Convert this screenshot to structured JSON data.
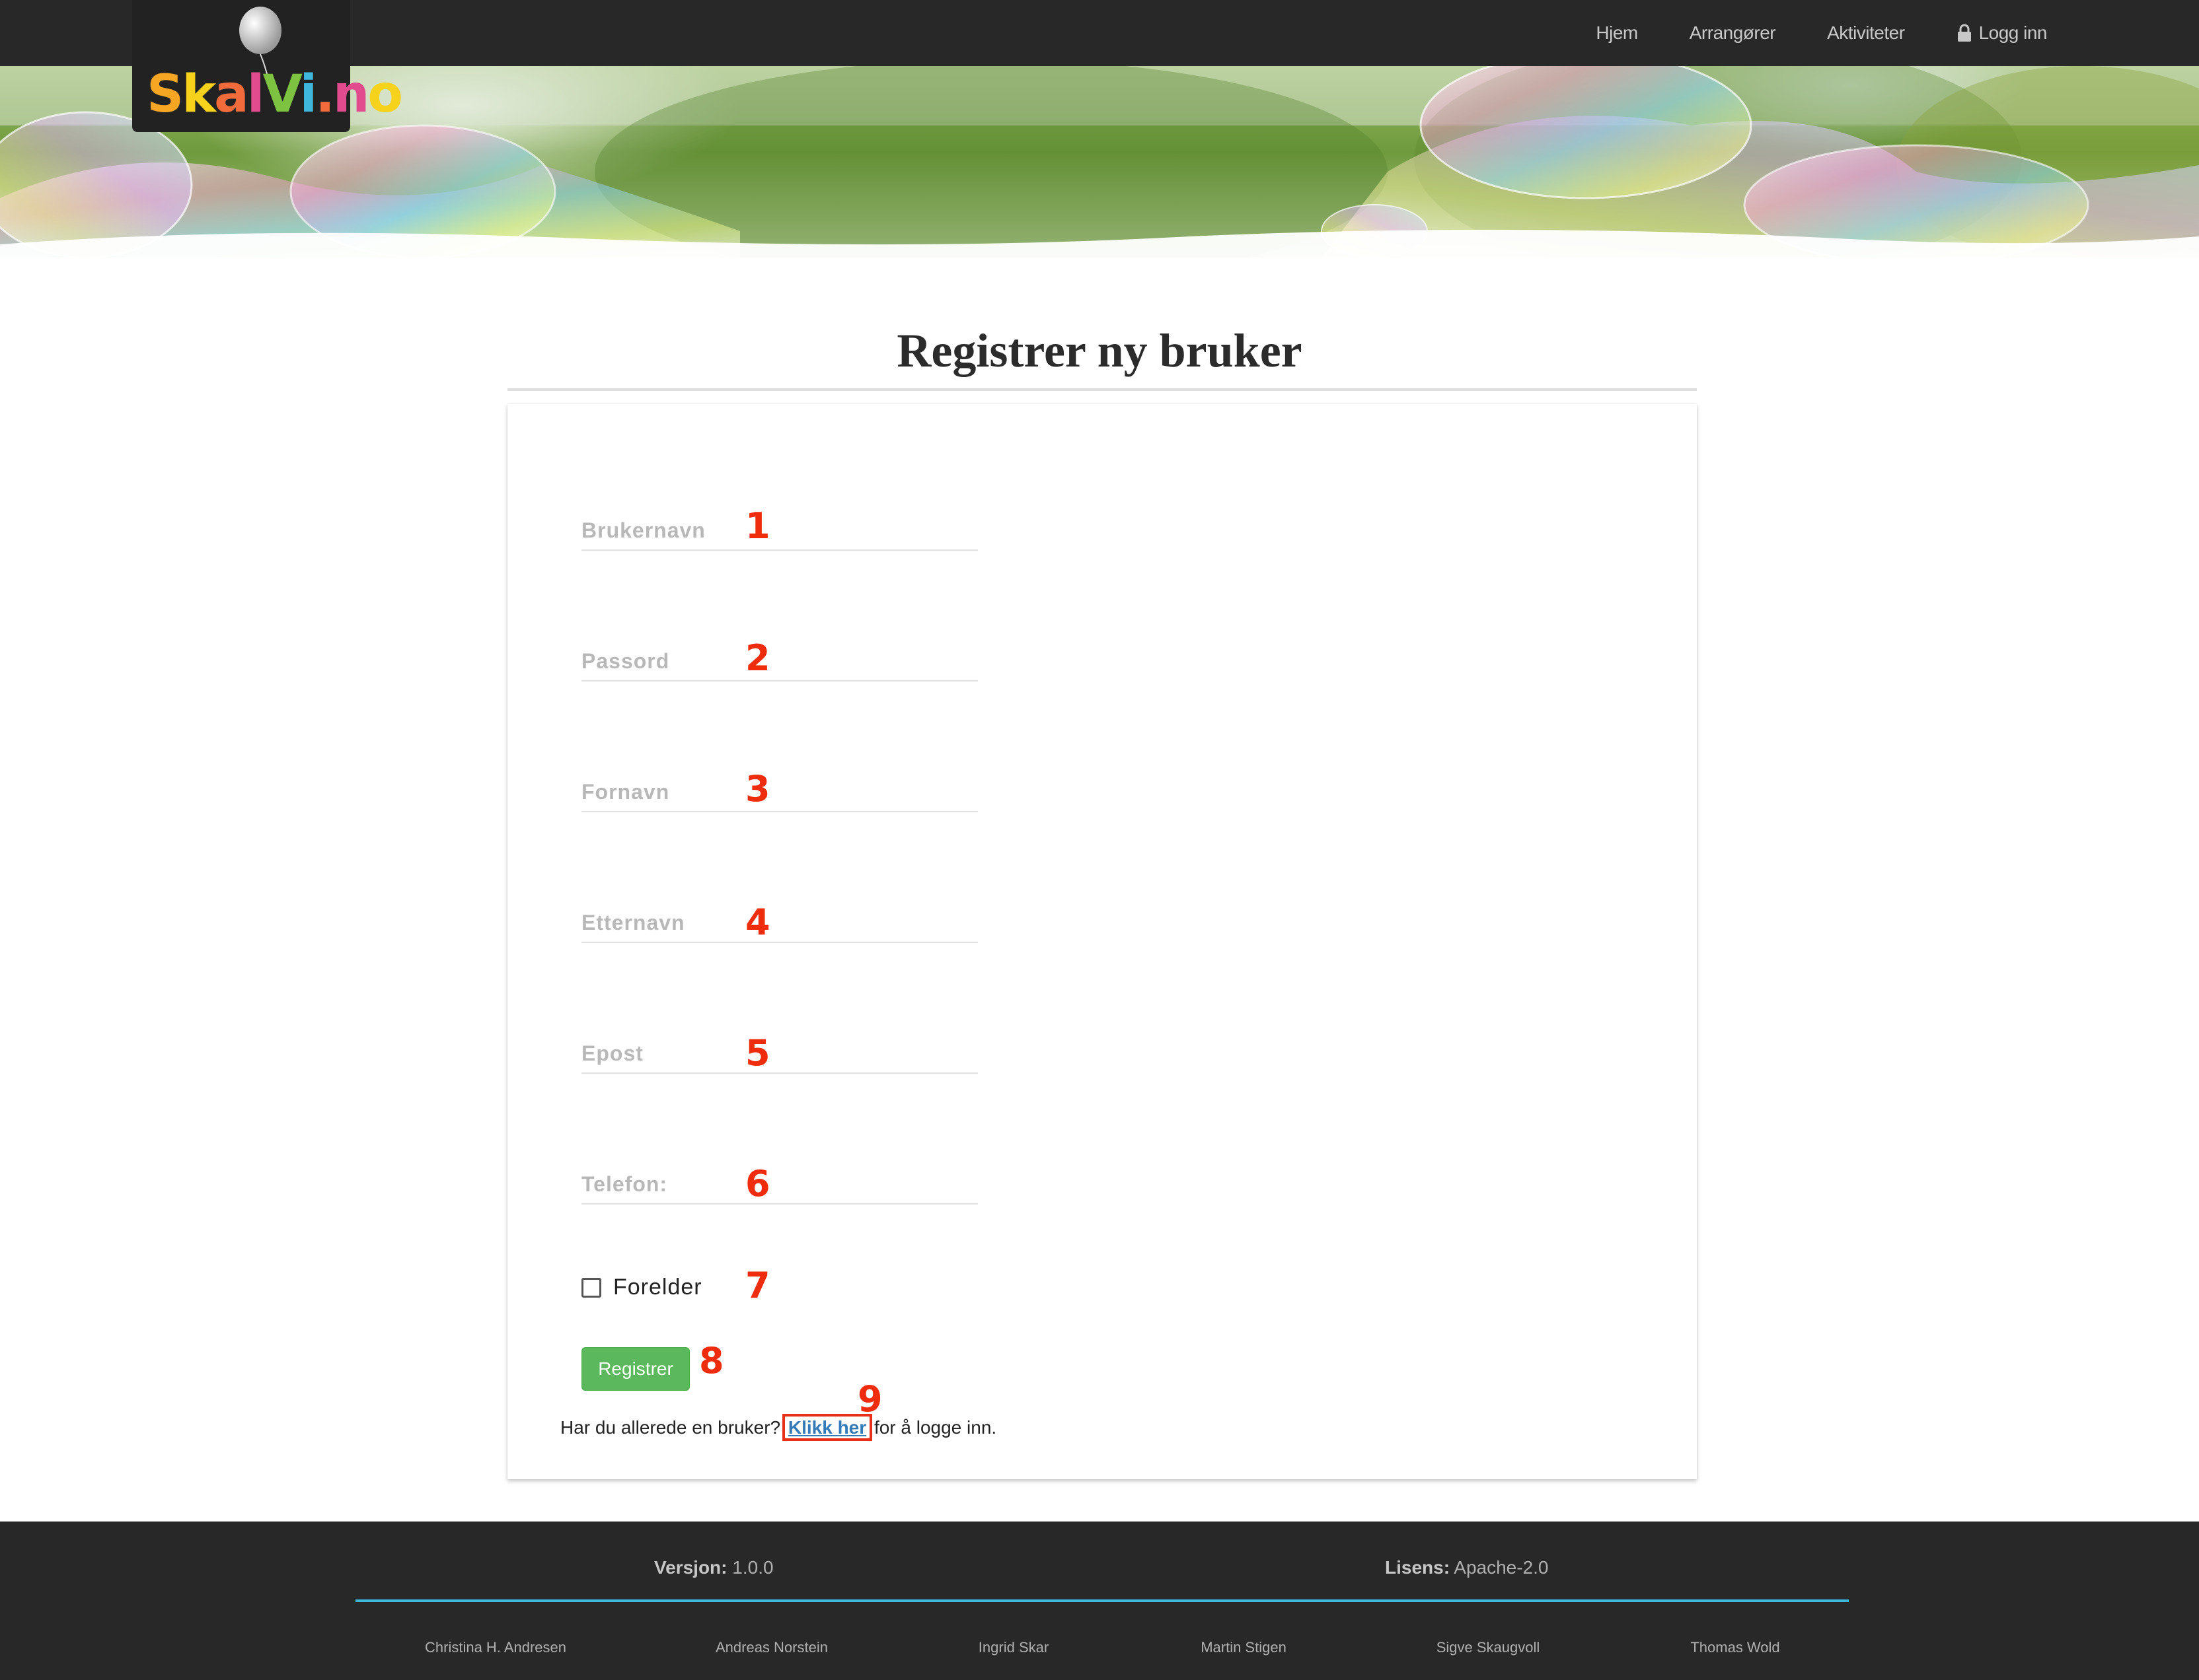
{
  "nav": {
    "logo_text": "SkalVi.no",
    "links": [
      "Hjem",
      "Arrangører",
      "Aktiviteter"
    ],
    "login_label": "Logg inn",
    "login_icon": "lock-icon"
  },
  "page": {
    "title": "Registrer ny bruker"
  },
  "form": {
    "fields": [
      {
        "label": "Brukernavn",
        "value": ""
      },
      {
        "label": "Passord",
        "value": ""
      },
      {
        "label": "Fornavn",
        "value": ""
      },
      {
        "label": "Etternavn",
        "value": ""
      },
      {
        "label": "Epost",
        "value": ""
      },
      {
        "label": "Telefon:",
        "value": ""
      }
    ],
    "checkbox_label": "Forelder",
    "checkbox_checked": false,
    "submit_label": "Registrer",
    "login_prompt": "Har du allerede en bruker?",
    "login_link": "Klikk her",
    "login_suffix": "for å logge inn."
  },
  "annotations": [
    "1",
    "2",
    "3",
    "4",
    "5",
    "6",
    "7",
    "8",
    "9"
  ],
  "annotation_color": "#ef2c0c",
  "accent_colors": {
    "button": "#5cb85c",
    "link": "#337ab7",
    "footer_rule": "#3fb6dc",
    "nav_bg": "#282828"
  },
  "footer": {
    "version_label": "Versjon:",
    "version_value": "1.0.0",
    "license_label": "Lisens:",
    "license_value": "Apache-2.0",
    "authors": [
      "Christina H. Andresen",
      "Andreas Norstein",
      "Ingrid Skar",
      "Martin Stigen",
      "Sigve Skaugvoll",
      "Thomas Wold"
    ]
  }
}
